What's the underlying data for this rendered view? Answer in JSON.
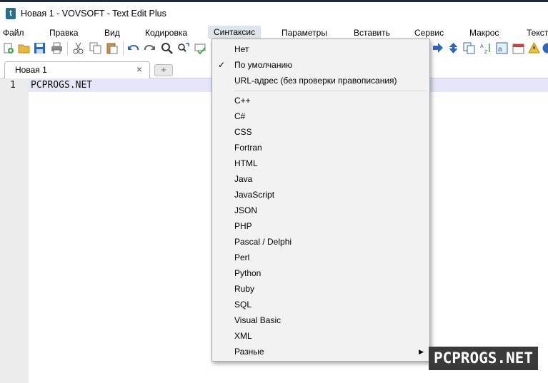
{
  "window": {
    "title": "Новая 1 - VOVSOFT - Text Edit Plus"
  },
  "menu": {
    "items": [
      {
        "label": "Файл"
      },
      {
        "label": "Правка"
      },
      {
        "label": "Вид"
      },
      {
        "label": "Кодировка"
      },
      {
        "label": "Синтаксис"
      },
      {
        "label": "Параметры"
      },
      {
        "label": "Вставить"
      },
      {
        "label": "Сервис"
      },
      {
        "label": "Макрос"
      },
      {
        "label": "Текст"
      }
    ]
  },
  "toolbar": {
    "icons": [
      "new-file-icon",
      "open-folder-icon",
      "save-icon",
      "print-icon",
      "cut-icon",
      "copy-icon",
      "paste-icon",
      "undo-icon",
      "redo-icon",
      "find-icon",
      "replace-icon",
      "spellcheck-icon",
      "move-down-icon",
      "move-down-blue-icon",
      "duplicate-icon",
      "sort-icon",
      "unicode-icon",
      "calendar-icon",
      "warning-icon",
      "help-icon"
    ]
  },
  "tabs": [
    {
      "label": "Новая 1",
      "close": "×"
    }
  ],
  "tab_add_label": "+",
  "editor": {
    "line_number": "1",
    "line_text": "PCPROGS.NET"
  },
  "syntax_menu": {
    "group1": [
      {
        "label": "Нет",
        "checked": false
      },
      {
        "label": "По умолчанию",
        "checked": true
      },
      {
        "label": "URL-адрес (без проверки правописания)",
        "checked": false
      }
    ],
    "group2": [
      {
        "label": "C++"
      },
      {
        "label": "C#"
      },
      {
        "label": "CSS"
      },
      {
        "label": "Fortran"
      },
      {
        "label": "HTML"
      },
      {
        "label": "Java"
      },
      {
        "label": "JavaScript"
      },
      {
        "label": "JSON"
      },
      {
        "label": "PHP"
      },
      {
        "label": "Pascal / Delphi"
      },
      {
        "label": "Perl"
      },
      {
        "label": "Python"
      },
      {
        "label": "Ruby"
      },
      {
        "label": "SQL"
      },
      {
        "label": "Visual Basic"
      },
      {
        "label": "XML"
      },
      {
        "label": "Разные",
        "submenu": true
      }
    ],
    "check_mark": "✓",
    "submenu_arrow": "▶"
  },
  "watermark": "PCPROGS.NET"
}
